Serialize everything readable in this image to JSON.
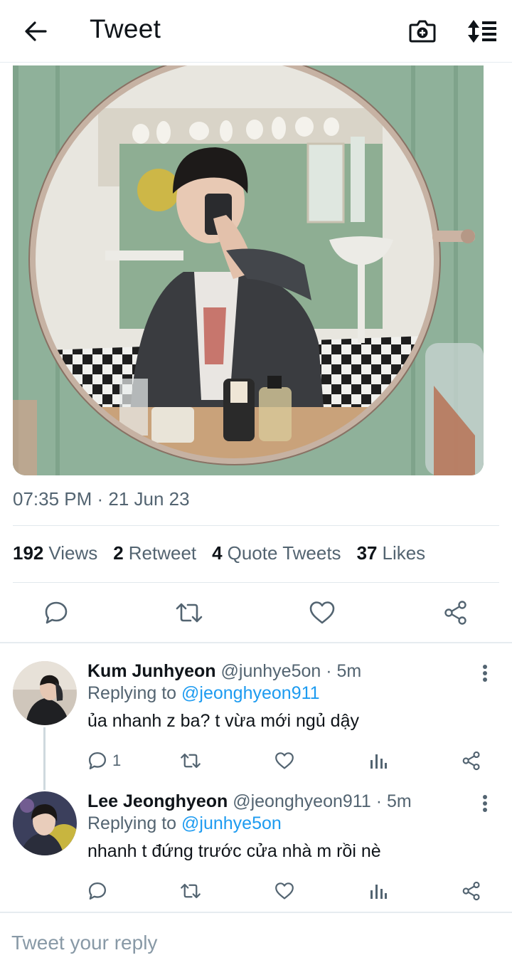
{
  "header": {
    "title": "Tweet",
    "back_icon": "arrow-left-icon",
    "camera_icon": "camera-plus-icon",
    "sort_icon": "sort-lines-icon"
  },
  "tweet": {
    "timestamp": "07:35 PM · 21 Jun 23",
    "stats": [
      {
        "count": "192",
        "label": "Views"
      },
      {
        "count": "2",
        "label": "Retweet"
      },
      {
        "count": "4",
        "label": "Quote Tweets"
      },
      {
        "count": "37",
        "label": "Likes"
      }
    ],
    "actions": [
      "reply-icon",
      "retweet-icon",
      "like-icon",
      "share-icon"
    ]
  },
  "replies": [
    {
      "name": "Kum Junhyeon",
      "handle": "@junhye5on",
      "time": "· 5m",
      "replying_prefix": "Replying to",
      "replying_to": "@jeonghyeon911",
      "text": "ủa nhanh z ba? t vừa mới ngủ dậy",
      "reply_count": "1"
    },
    {
      "name": "Lee Jeonghyeon",
      "handle": "@jeonghyeon911",
      "time": "· 5m",
      "replying_prefix": "Replying to",
      "replying_to": "@junhye5on",
      "text": "nhanh t đứng trước cửa nhà m rồi nè",
      "reply_count": ""
    }
  ],
  "compose": {
    "placeholder": "Tweet your reply"
  },
  "colors": {
    "accent": "#1d9bf0",
    "text": "#0f1419",
    "muted": "#536471",
    "wall": "#8fb19a"
  }
}
